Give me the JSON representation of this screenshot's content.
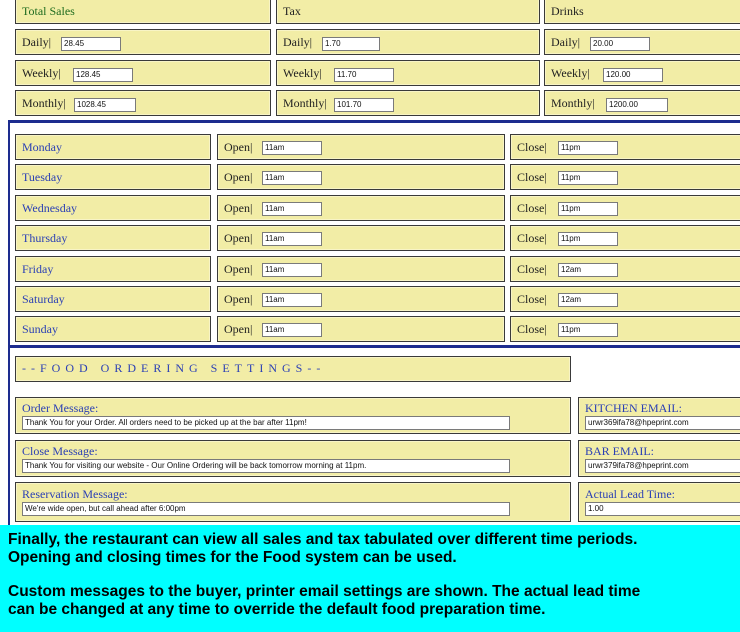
{
  "sales": {
    "total_sales": {
      "title": "Total Sales",
      "daily_label": "Daily",
      "daily": "28.45",
      "weekly_label": "Weekly",
      "weekly": "128.45",
      "monthly_label": "Monthly",
      "monthly": "1028.45"
    },
    "tax": {
      "title": "Tax",
      "daily_label": "Daily",
      "daily": "1.70",
      "weekly_label": "Weekly",
      "weekly": "11.70",
      "monthly_label": "Monthly",
      "monthly": "101.70"
    },
    "drinks": {
      "title": "Drinks",
      "daily_label": "Daily",
      "daily": "20.00",
      "weekly_label": "Weekly",
      "weekly": "120.00",
      "monthly_label": "Monthly",
      "monthly": "1200.00"
    }
  },
  "hours": {
    "open_label": "Open",
    "close_label": "Close",
    "days": [
      {
        "day": "Monday",
        "open": "11am",
        "close": "11pm"
      },
      {
        "day": "Tuesday",
        "open": "11am",
        "close": "11pm"
      },
      {
        "day": "Wednesday",
        "open": "11am",
        "close": "11pm"
      },
      {
        "day": "Thursday",
        "open": "11am",
        "close": "11pm"
      },
      {
        "day": "Friday",
        "open": "11am",
        "close": "12am"
      },
      {
        "day": "Saturday",
        "open": "11am",
        "close": "12am"
      },
      {
        "day": "Sunday",
        "open": "11am",
        "close": "11pm"
      }
    ]
  },
  "food_settings": {
    "heading": "--FOOD ORDERING SETTINGS--",
    "order_message_label": "Order Message:",
    "order_message": "Thank You for your Order.  All orders need to be picked up at the bar after 11pm!",
    "close_message_label": "Close Message:",
    "close_message": "Thank You for visiting our website - Our Online Ordering will be back tomorrow morning at 11pm.",
    "reservation_message_label": "Reservation Message:",
    "reservation_message": "We're wide open,  but call ahead after 6:00pm",
    "kitchen_email_label": "KITCHEN EMAIL:",
    "kitchen_email": "urwr369ifa78@hpeprint.com",
    "bar_email_label": "BAR EMAIL:",
    "bar_email": "urwr379ifa78@hpeprint.com",
    "lead_time_label": "Actual Lead Time:",
    "lead_time": "1.00"
  },
  "caption": {
    "line1": "Finally, the restaurant can view all sales and tax tabulated over different time periods.",
    "line2": "Opening and closing times for the Food system can be used.",
    "line3": "Custom messages to the buyer, printer email settings are shown.  The actual lead time",
    "line4": "can be changed at any time to override the default food preparation time."
  }
}
